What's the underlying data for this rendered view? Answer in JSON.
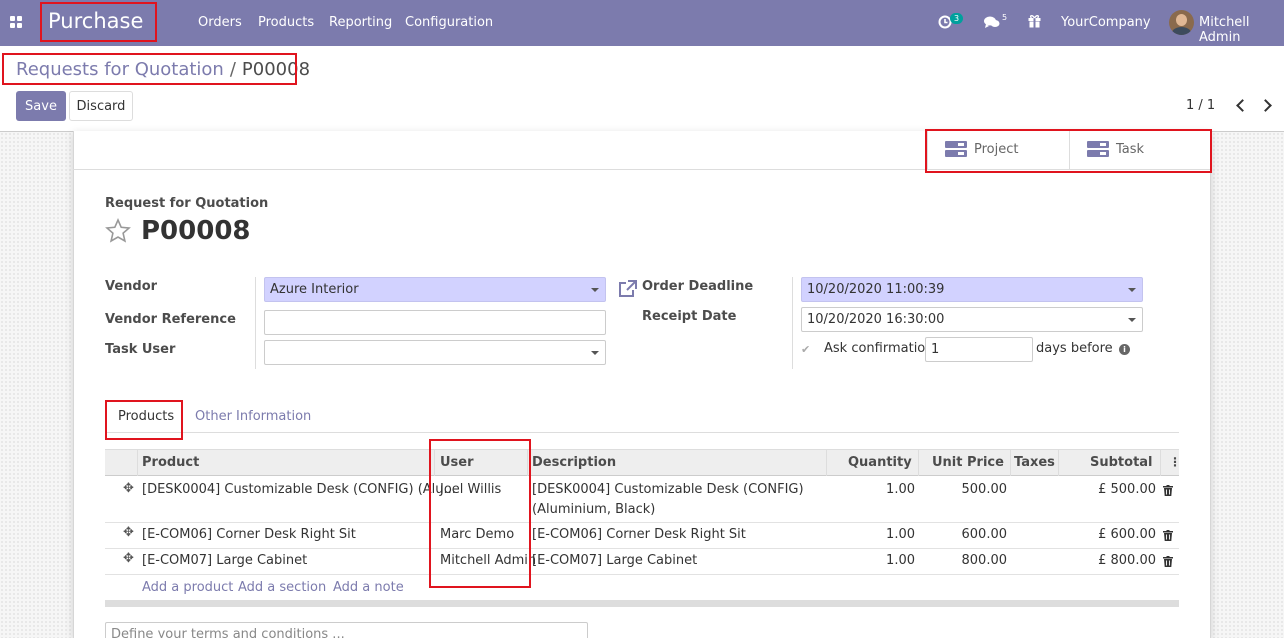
{
  "navbar": {
    "brand": "Purchase",
    "menu": [
      "Orders",
      "Products",
      "Reporting",
      "Configuration"
    ],
    "activity_count": "3",
    "message_count": "5",
    "company": "YourCompany",
    "user": "Mitchell Admin"
  },
  "breadcrumb": {
    "parent": "Requests for Quotation",
    "separator": "/",
    "current": "P00008"
  },
  "actions": {
    "save": "Save",
    "discard": "Discard"
  },
  "pager": {
    "value": "1 / 1"
  },
  "smart_buttons": [
    {
      "label": "Project",
      "icon": "server-icon"
    },
    {
      "label": "Task",
      "icon": "server-icon"
    }
  ],
  "form": {
    "subtitle": "Request for Quotation",
    "name": "P00008",
    "vendor_label": "Vendor",
    "vendor_value": "Azure Interior",
    "vendor_ref_label": "Vendor Reference",
    "vendor_ref_value": "",
    "task_user_label": "Task User",
    "task_user_value": "",
    "order_deadline_label": "Order Deadline",
    "order_deadline_value": "10/20/2020 11:00:39",
    "receipt_date_label": "Receipt Date",
    "receipt_date_value": "10/20/2020 16:30:00",
    "ask_confirmation_label": "Ask confirmation",
    "ask_confirmation_value": "1",
    "days_before_label": "days before"
  },
  "tabs": [
    "Products",
    "Other Information"
  ],
  "table": {
    "columns": [
      "Product",
      "User",
      "Description",
      "Quantity",
      "Unit Price",
      "Taxes",
      "Subtotal"
    ],
    "rows": [
      {
        "product": "[DESK0004] Customizable Desk (CONFIG) (Alu...",
        "user": "Joel Willis",
        "description_1": "[DESK0004] Customizable Desk (CONFIG)",
        "description_2": "(Aluminium, Black)",
        "quantity": "1.00",
        "unit_price": "500.00",
        "taxes": "",
        "subtotal": "£ 500.00"
      },
      {
        "product": "[E-COM06] Corner Desk Right Sit",
        "user": "Marc Demo",
        "description_1": "[E-COM06] Corner Desk Right Sit",
        "description_2": "",
        "quantity": "1.00",
        "unit_price": "600.00",
        "taxes": "",
        "subtotal": "£ 600.00"
      },
      {
        "product": "[E-COM07] Large Cabinet",
        "user": "Mitchell Admin",
        "description_1": "[E-COM07] Large Cabinet",
        "description_2": "",
        "quantity": "1.00",
        "unit_price": "800.00",
        "taxes": "",
        "subtotal": "£ 800.00"
      }
    ],
    "add_links": [
      "Add a product",
      "Add a section",
      "Add a note"
    ]
  },
  "terms": {
    "placeholder": "Define your terms and conditions ..."
  },
  "colors": {
    "primary": "#7c7bad",
    "highlight": "#e0141e",
    "required_bg": "#d2d2ff"
  }
}
